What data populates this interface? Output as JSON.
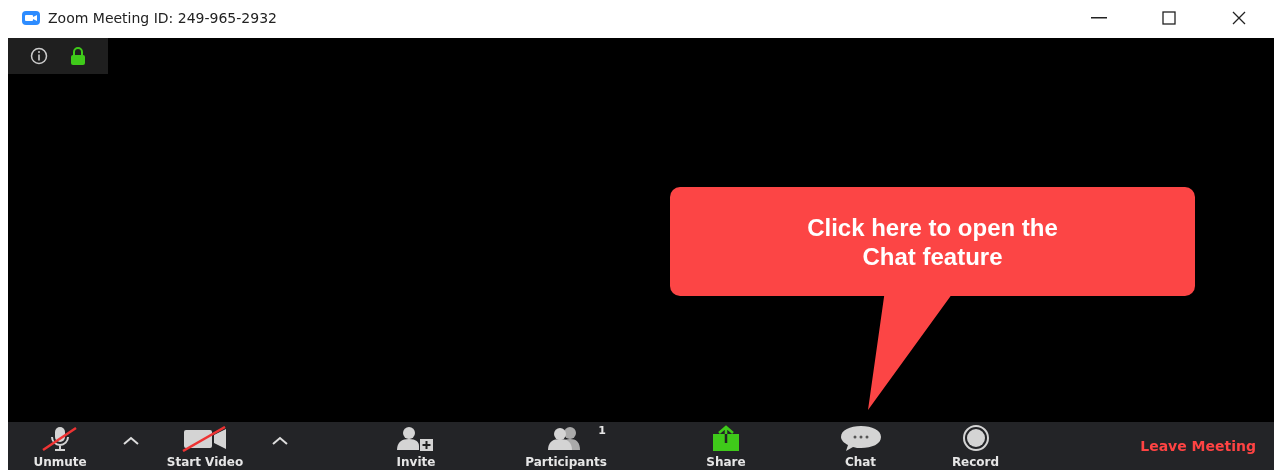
{
  "window": {
    "title": "Zoom Meeting ID: 249-965-2932"
  },
  "toolbar": [
    {
      "kind": "mic",
      "label": "Unmute",
      "muted": true
    },
    {
      "kind": "caret"
    },
    {
      "kind": "video",
      "label": "Start Video",
      "muted": true
    },
    {
      "kind": "caret"
    },
    {
      "kind": "invite",
      "label": "Invite"
    },
    {
      "kind": "participants",
      "label": "Participants",
      "count": "1"
    },
    {
      "kind": "share",
      "label": "Share"
    },
    {
      "kind": "chat",
      "label": "Chat"
    },
    {
      "kind": "record",
      "label": "Record"
    }
  ],
  "leave_button": "Leave Meeting",
  "callout": {
    "text": "Click here to open the Chat feature"
  }
}
